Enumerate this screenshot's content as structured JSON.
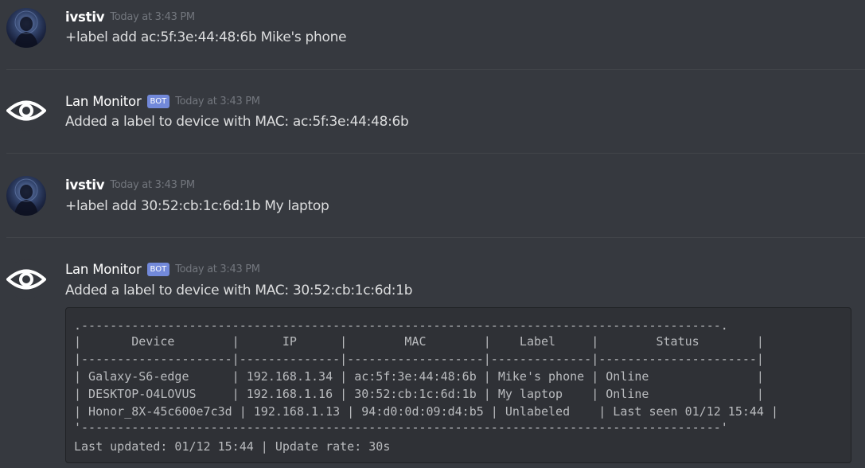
{
  "messages": [
    {
      "author": "ivstiv",
      "is_bot": false,
      "timestamp": "Today at 3:43 PM",
      "text": "+label add ac:5f:3e:44:48:6b Mike's phone"
    },
    {
      "author": "Lan Monitor",
      "is_bot": true,
      "badge": "BOT",
      "timestamp": "Today at 3:43 PM",
      "text": "Added a label to device with MAC: ac:5f:3e:44:48:6b"
    },
    {
      "author": "ivstiv",
      "is_bot": false,
      "timestamp": "Today at 3:43 PM",
      "text": "+label add 30:52:cb:1c:6d:1b My laptop"
    },
    {
      "author": "Lan Monitor",
      "is_bot": true,
      "badge": "BOT",
      "timestamp": "Today at 3:43 PM",
      "text": "Added a label to device with MAC: 30:52:cb:1c:6d:1b"
    }
  ],
  "device_table": {
    "border_top": ".-----------------------------------------------------------------------------------------.",
    "header_row": "|       Device        |      IP      |        MAC        |    Label     |        Status        |",
    "separator": "|---------------------|--------------|-------------------|--------------|----------------------|",
    "columns": [
      "Device",
      "IP",
      "MAC",
      "Label",
      "Status"
    ],
    "rows": [
      {
        "line": "| Galaxy-S6-edge      | 192.168.1.34 | ac:5f:3e:44:48:6b | Mike's phone | Online               |",
        "device": "Galaxy-S6-edge",
        "ip": "192.168.1.34",
        "mac": "ac:5f:3e:44:48:6b",
        "label": "Mike's phone",
        "status": "Online"
      },
      {
        "line": "| DESKTOP-O4LOVUS     | 192.168.1.16 | 30:52:cb:1c:6d:1b | My laptop    | Online               |",
        "device": "DESKTOP-O4LOVUS",
        "ip": "192.168.1.16",
        "mac": "30:52:cb:1c:6d:1b",
        "label": "My laptop",
        "status": "Online"
      },
      {
        "line": "| Honor_8X-45c600e7c3d | 192.168.1.13 | 94:d0:0d:09:d4:b5 | Unlabeled    | Last seen 01/12 15:44 |",
        "device": "Honor_8X-45c600e7c3d",
        "ip": "192.168.1.13",
        "mac": "94:d0:0d:09:d4:b5",
        "label": "Unlabeled",
        "status": "Last seen 01/12 15:44"
      }
    ],
    "border_bottom": "'-----------------------------------------------------------------------------------------'",
    "footer": "Last updated: 01/12 15:44 | Update rate: 30s"
  },
  "icons": {
    "user_avatar": "user-avatar",
    "bot_avatar": "eye-icon"
  },
  "colors": {
    "background": "#36393f",
    "bot_badge": "#7289da",
    "timestamp": "#72767d",
    "codeblock_bg": "#2f3136"
  }
}
